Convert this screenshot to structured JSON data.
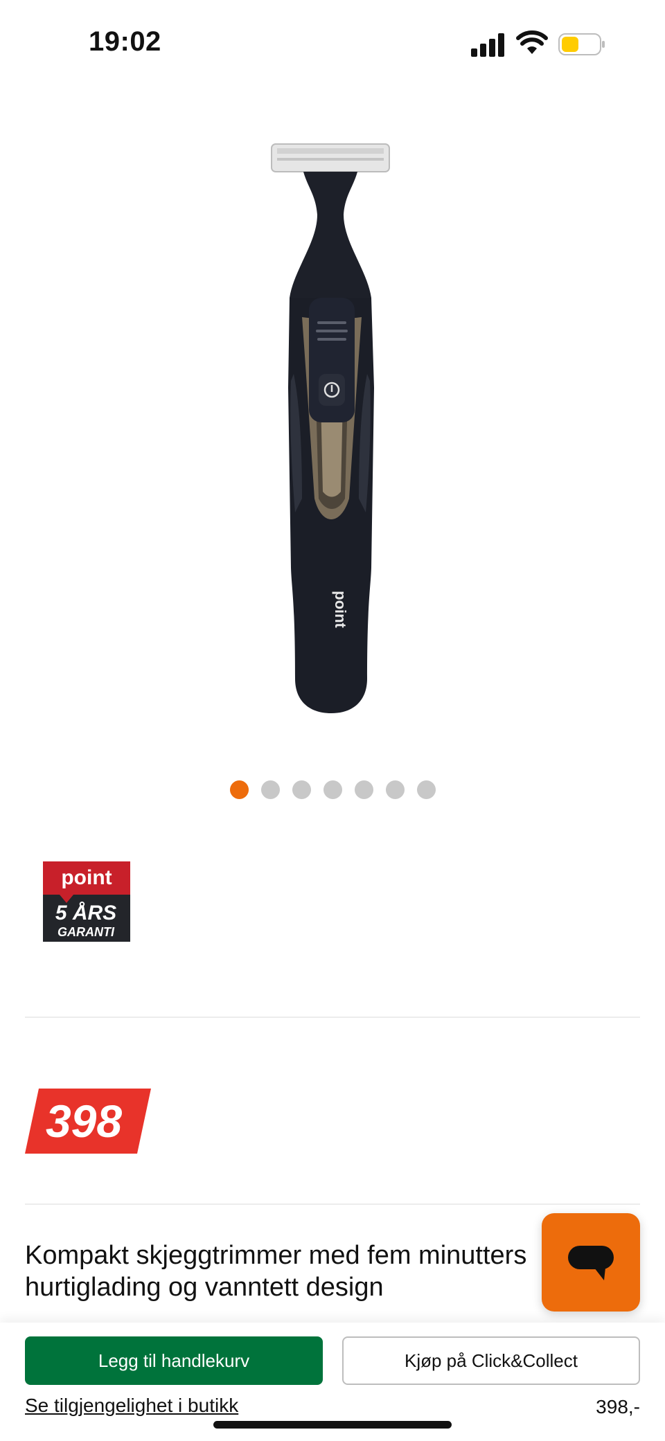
{
  "status_bar": {
    "time": "19:02",
    "icons": [
      "cellular-signal-icon",
      "wifi-icon",
      "battery-icon"
    ],
    "battery_color": "#ffcc00"
  },
  "product": {
    "image_brand_text": "point",
    "gallery": {
      "total": 7,
      "active_index": 0
    },
    "warranty_badge": {
      "brand": "point",
      "years": "5 ÅRS",
      "label": "GARANTI"
    },
    "price_tag": "398",
    "title": "Kompakt skjeggtrimmer med fem minutters hurtiglading og vanntett design"
  },
  "actions": {
    "add_to_cart": "Legg til handlekurv",
    "click_collect": "Kjøp på Click&Collect",
    "availability_link": "Se tilgjengelighet i butikk",
    "price": "398,-"
  },
  "colors": {
    "accent_orange": "#ed6c0c",
    "price_red": "#e8332a",
    "cart_green": "#00733b"
  }
}
